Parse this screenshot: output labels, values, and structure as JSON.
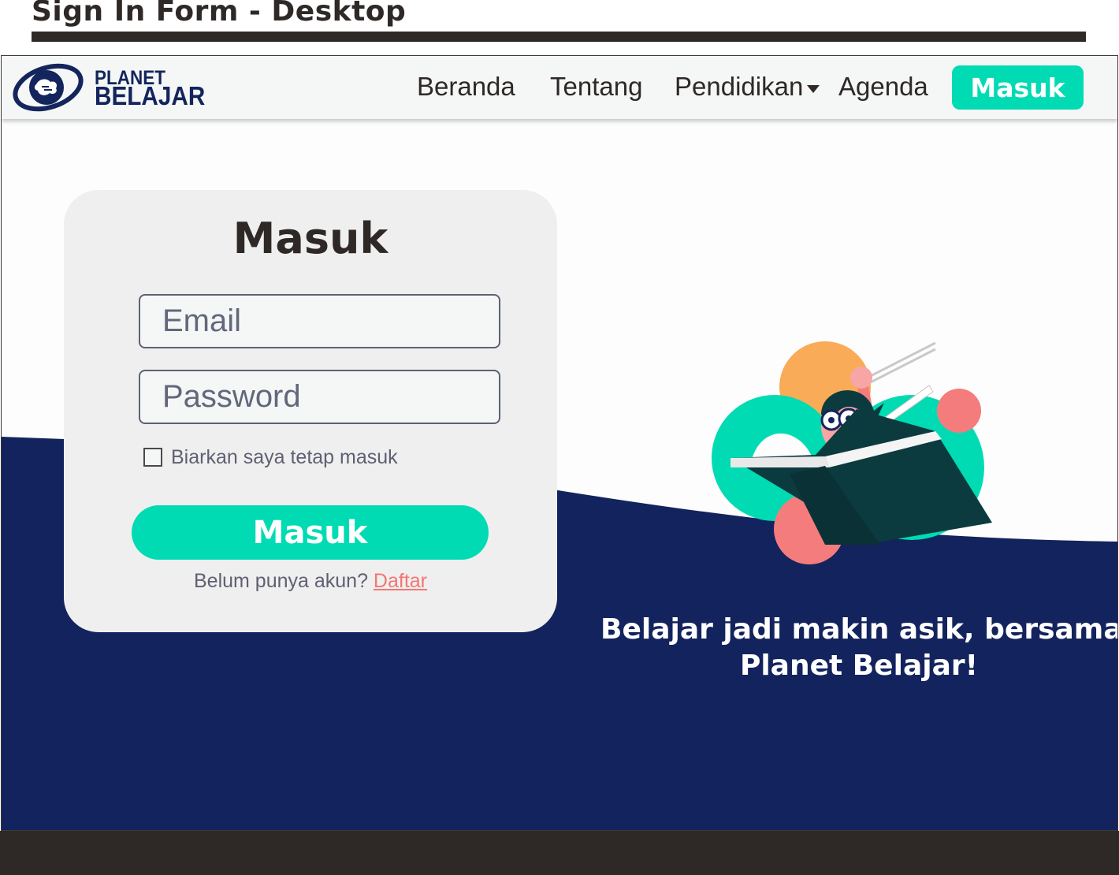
{
  "doc": {
    "title": "Sign In Form - Desktop"
  },
  "navbar": {
    "logo_top": "PLANET",
    "logo_bottom": "BELAJAR",
    "items": [
      {
        "label": "Beranda"
      },
      {
        "label": "Tentang"
      },
      {
        "label": "Pendidikan",
        "has_dropdown": true
      },
      {
        "label": "Agenda"
      }
    ],
    "button_label": "Masuk"
  },
  "login": {
    "title": "Masuk",
    "email_placeholder": "Email",
    "password_placeholder": "Password",
    "remember_label": "Biarkan saya tetap masuk",
    "remember_checked": false,
    "submit_label": "Masuk",
    "signup_prompt": "Belum punya akun?",
    "signup_link": "Daftar"
  },
  "hero": {
    "tagline_line1": "Belajar jadi makin asik, bersama",
    "tagline_line2": "Planet Belajar!"
  },
  "colors": {
    "brand_navy": "#13235d",
    "accent_teal": "#00dbb3",
    "link_coral": "#f37575",
    "dark": "#2e2926",
    "card_bg": "#efefef"
  },
  "icons": [
    "planet-logo-icon",
    "chevron-down-icon",
    "checkbox-icon"
  ]
}
